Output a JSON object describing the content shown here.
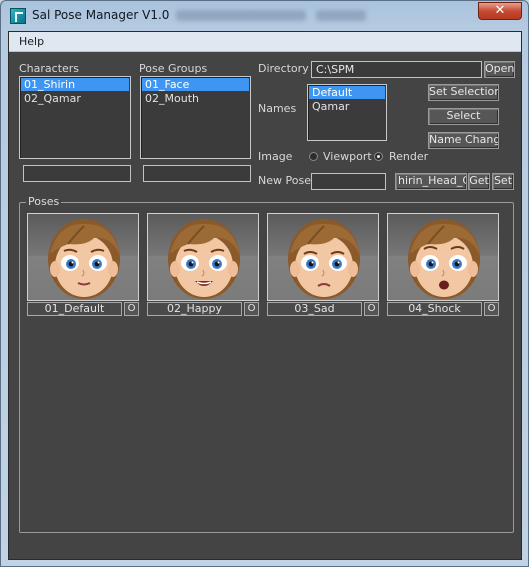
{
  "window": {
    "title": "Sal Pose Manager V1.0",
    "close_glyph": "✕"
  },
  "menu": {
    "help": "Help"
  },
  "characters": {
    "label": "Characters",
    "items": [
      "01_Shirin",
      "02_Qamar"
    ],
    "selected_index": 0,
    "field_value": ""
  },
  "pose_groups": {
    "label": "Pose Groups",
    "items": [
      "01_Face",
      "02_Mouth"
    ],
    "selected_index": 0,
    "field_value": ""
  },
  "directory": {
    "label": "Directory",
    "value": "C:\\SPM",
    "open_label": "Open"
  },
  "names": {
    "label": "Names",
    "items": [
      "Default",
      "Qamar"
    ],
    "selected_index": 0
  },
  "buttons": {
    "set_selection": "Set Selection",
    "select": "Select",
    "name_change": "Name Change"
  },
  "image": {
    "label": "Image",
    "options": [
      "Viewport",
      "Render"
    ],
    "selected": "Render"
  },
  "new_pose": {
    "label": "New Pose",
    "value": "",
    "ctrl_value": "hirin_Head_Ctrl",
    "get_label": "Get",
    "set_label": "Set"
  },
  "poses": {
    "title": "Poses",
    "items": [
      {
        "name": "01_Default",
        "button": "O",
        "mood": "default"
      },
      {
        "name": "02_Happy",
        "button": "O",
        "mood": "happy"
      },
      {
        "name": "03_Sad",
        "button": "O",
        "mood": "sad"
      },
      {
        "name": "04_Shock",
        "button": "O",
        "mood": "shock"
      }
    ]
  },
  "colors": {
    "panel_bg": "#444444",
    "selection": "#3f96f2",
    "title_bar": "#b6cbe0",
    "close_red": "#c74a32"
  }
}
